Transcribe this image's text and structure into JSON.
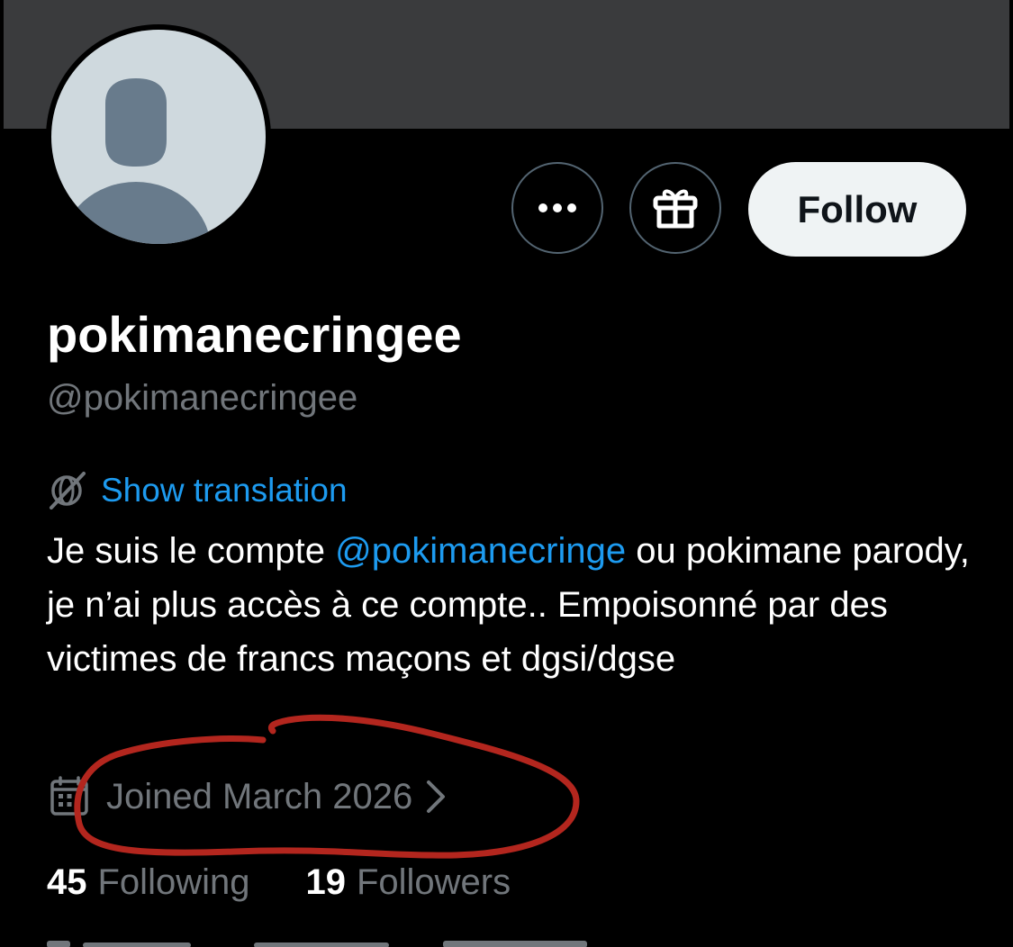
{
  "profile": {
    "display_name": "pokimanecringee",
    "handle": "@pokimanecringee",
    "follow_label": "Follow",
    "translate_label": "Show translation",
    "bio": {
      "part1": "Je suis le compte ",
      "mention": "@pokimanecringe",
      "part2": " ou pokimane parody, je n’ai plus accès à ce compte.. Empoisonné par des victimes de francs maçons et dgsi/dgse"
    },
    "joined": "Joined March 2026",
    "following_count": "45",
    "following_label": "Following",
    "followers_count": "19",
    "followers_label": "Followers"
  },
  "icons": {
    "more": "more-dots-icon",
    "gift": "gift-icon",
    "translate": "translate-globe-icon",
    "calendar": "calendar-icon",
    "chevron": "chevron-right-icon"
  },
  "colors": {
    "background": "#000000",
    "banner": "#3a3b3d",
    "link": "#1d9bf0",
    "secondary_text": "#71767b",
    "follow_button": "#eff3f4",
    "annotation": "#b3261e"
  }
}
